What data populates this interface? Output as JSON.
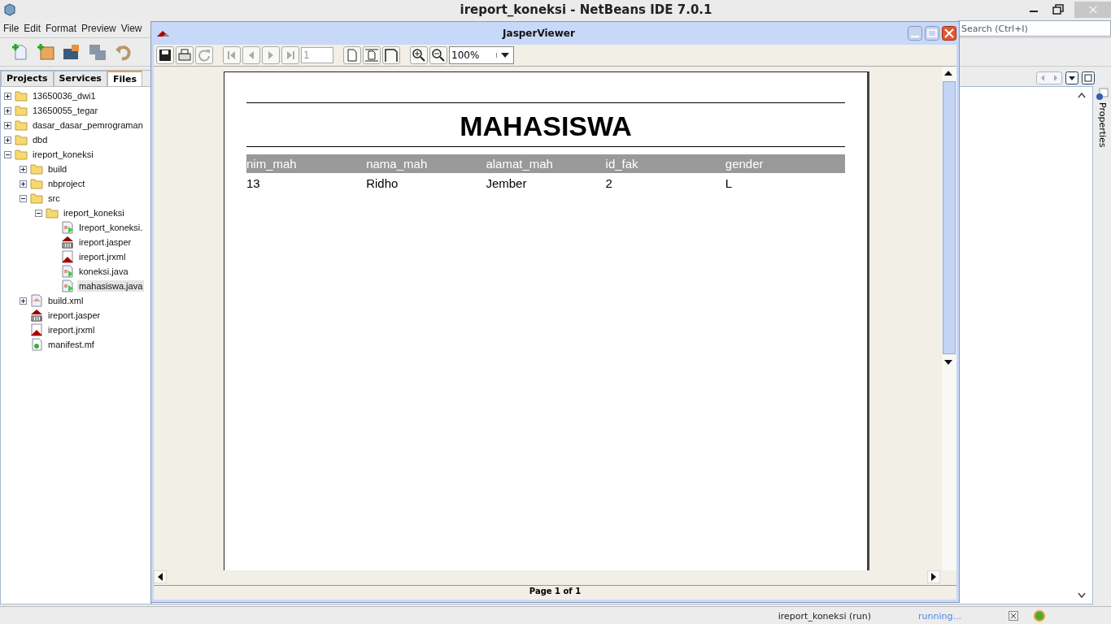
{
  "ide": {
    "title": "ireport_koneksi - NetBeans IDE 7.0.1",
    "menu": [
      "File",
      "Edit",
      "Format",
      "Preview",
      "View"
    ],
    "search": {
      "placeholder": "Search (Ctrl+I)"
    },
    "tabs": [
      {
        "label": "Projects",
        "selected": false
      },
      {
        "label": "Services",
        "selected": false
      },
      {
        "label": "Files",
        "selected": true
      }
    ],
    "tree": [
      {
        "label": "13650036_dwi1",
        "kind": "folder",
        "expanded": false,
        "selected": false
      },
      {
        "label": "13650055_tegar",
        "kind": "folder",
        "expanded": false,
        "selected": false
      },
      {
        "label": "dasar_dasar_pemrograman",
        "kind": "folder",
        "expanded": false,
        "selected": false
      },
      {
        "label": "dbd",
        "kind": "folder",
        "expanded": false,
        "selected": false
      },
      {
        "label": "ireport_koneksi",
        "kind": "folder",
        "expanded": true,
        "selected": false,
        "children": [
          {
            "label": "build",
            "kind": "folder",
            "expanded": false,
            "selected": false
          },
          {
            "label": "nbproject",
            "kind": "folder",
            "expanded": false,
            "selected": false
          },
          {
            "label": "src",
            "kind": "folder",
            "expanded": true,
            "selected": false,
            "children": [
              {
                "label": "ireport_koneksi",
                "kind": "folder",
                "expanded": true,
                "selected": false,
                "children": [
                  {
                    "label": "Ireport_koneksi.",
                    "kind": "java",
                    "selected": false
                  },
                  {
                    "label": "ireport.jasper",
                    "kind": "jasper",
                    "selected": false
                  },
                  {
                    "label": "ireport.jrxml",
                    "kind": "jrxml",
                    "selected": false
                  },
                  {
                    "label": "koneksi.java",
                    "kind": "java",
                    "selected": false
                  },
                  {
                    "label": "mahasiswa.java",
                    "kind": "java",
                    "selected": true
                  }
                ]
              }
            ]
          },
          {
            "label": "build.xml",
            "kind": "xml",
            "expanded": false,
            "selected": false
          },
          {
            "label": "ireport.jasper",
            "kind": "jasper",
            "selected": false
          },
          {
            "label": "ireport.jrxml",
            "kind": "jrxml",
            "selected": false
          },
          {
            "label": "manifest.mf",
            "kind": "mf",
            "selected": false
          }
        ]
      }
    ],
    "properties_label": "Properties",
    "status": {
      "task": "ireport_koneksi (run)",
      "progress": "running..."
    }
  },
  "viewer": {
    "title": "JasperViewer",
    "page_number": "1",
    "zoom": "100%",
    "page_status": "Page 1 of 1",
    "report": {
      "title": "MAHASISWA",
      "columns": [
        "nim_mah",
        "nama_mah",
        "alamat_mah",
        "id_fak",
        "gender"
      ],
      "rows": [
        [
          "13",
          "Ridho",
          "Jember",
          "2",
          "L"
        ]
      ]
    }
  }
}
